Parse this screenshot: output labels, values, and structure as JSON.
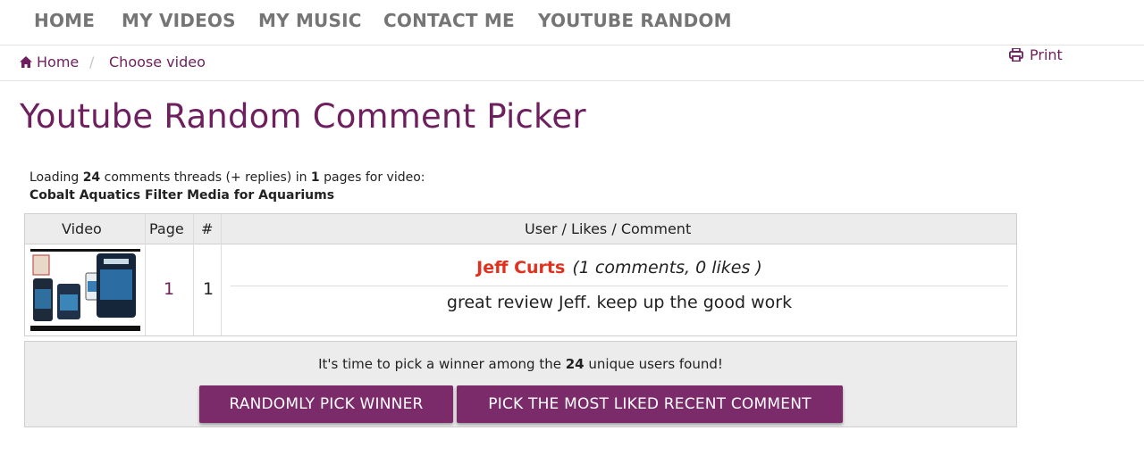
{
  "nav": {
    "items": [
      {
        "label": "HOME"
      },
      {
        "label": "MY VIDEOS"
      },
      {
        "label": "MY MUSIC"
      },
      {
        "label": "CONTACT ME"
      },
      {
        "label": "YOUTUBE RANDOM"
      }
    ]
  },
  "breadcrumb": {
    "home": "Home",
    "separator": "/",
    "current": "Choose video",
    "home_icon": "home-icon"
  },
  "print": {
    "label": "Print",
    "icon": "print-icon"
  },
  "page_title": "Youtube Random Comment Picker",
  "loading": {
    "prefix": "Loading",
    "comment_count": "24",
    "mid": "comments threads (+ replies) in",
    "page_count": "1",
    "suffix": "pages for video:",
    "video_title": "Cobalt Aquatics Filter Media for Aquariums"
  },
  "table": {
    "headers": {
      "video": "Video",
      "page": "Page",
      "index": "#",
      "user": "User / Likes / Comment"
    },
    "row": {
      "page": "1",
      "index": "1",
      "user_name": "Jeff Curts",
      "user_stats": "(1 comments, 0 likes )",
      "comment": "great review Jeff. keep up the good work"
    }
  },
  "pick": {
    "prefix": "It's time to pick a winner among the",
    "count": "24",
    "suffix": "unique users found!",
    "random_button": "RANDOMLY PICK WINNER",
    "liked_button": "PICK THE MOST LIKED RECENT COMMENT"
  },
  "colors": {
    "brand": "#6e1f5e",
    "button": "#7b2a6a",
    "user_name": "#e0301e",
    "nav_text": "#757575"
  }
}
